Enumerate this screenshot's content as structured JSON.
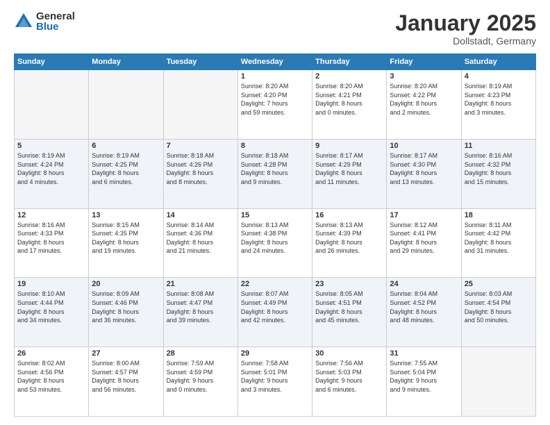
{
  "header": {
    "logo_general": "General",
    "logo_blue": "Blue",
    "month_title": "January 2025",
    "subtitle": "Dollstadt, Germany"
  },
  "days_of_week": [
    "Sunday",
    "Monday",
    "Tuesday",
    "Wednesday",
    "Thursday",
    "Friday",
    "Saturday"
  ],
  "weeks": [
    [
      {
        "day": "",
        "info": ""
      },
      {
        "day": "",
        "info": ""
      },
      {
        "day": "",
        "info": ""
      },
      {
        "day": "1",
        "info": "Sunrise: 8:20 AM\nSunset: 4:20 PM\nDaylight: 7 hours\nand 59 minutes."
      },
      {
        "day": "2",
        "info": "Sunrise: 8:20 AM\nSunset: 4:21 PM\nDaylight: 8 hours\nand 0 minutes."
      },
      {
        "day": "3",
        "info": "Sunrise: 8:20 AM\nSunset: 4:22 PM\nDaylight: 8 hours\nand 2 minutes."
      },
      {
        "day": "4",
        "info": "Sunrise: 8:19 AM\nSunset: 4:23 PM\nDaylight: 8 hours\nand 3 minutes."
      }
    ],
    [
      {
        "day": "5",
        "info": "Sunrise: 8:19 AM\nSunset: 4:24 PM\nDaylight: 8 hours\nand 4 minutes."
      },
      {
        "day": "6",
        "info": "Sunrise: 8:19 AM\nSunset: 4:25 PM\nDaylight: 8 hours\nand 6 minutes."
      },
      {
        "day": "7",
        "info": "Sunrise: 8:18 AM\nSunset: 4:26 PM\nDaylight: 8 hours\nand 8 minutes."
      },
      {
        "day": "8",
        "info": "Sunrise: 8:18 AM\nSunset: 4:28 PM\nDaylight: 8 hours\nand 9 minutes."
      },
      {
        "day": "9",
        "info": "Sunrise: 8:17 AM\nSunset: 4:29 PM\nDaylight: 8 hours\nand 11 minutes."
      },
      {
        "day": "10",
        "info": "Sunrise: 8:17 AM\nSunset: 4:30 PM\nDaylight: 8 hours\nand 13 minutes."
      },
      {
        "day": "11",
        "info": "Sunrise: 8:16 AM\nSunset: 4:32 PM\nDaylight: 8 hours\nand 15 minutes."
      }
    ],
    [
      {
        "day": "12",
        "info": "Sunrise: 8:16 AM\nSunset: 4:33 PM\nDaylight: 8 hours\nand 17 minutes."
      },
      {
        "day": "13",
        "info": "Sunrise: 8:15 AM\nSunset: 4:35 PM\nDaylight: 8 hours\nand 19 minutes."
      },
      {
        "day": "14",
        "info": "Sunrise: 8:14 AM\nSunset: 4:36 PM\nDaylight: 8 hours\nand 21 minutes."
      },
      {
        "day": "15",
        "info": "Sunrise: 8:13 AM\nSunset: 4:38 PM\nDaylight: 8 hours\nand 24 minutes."
      },
      {
        "day": "16",
        "info": "Sunrise: 8:13 AM\nSunset: 4:39 PM\nDaylight: 8 hours\nand 26 minutes."
      },
      {
        "day": "17",
        "info": "Sunrise: 8:12 AM\nSunset: 4:41 PM\nDaylight: 8 hours\nand 29 minutes."
      },
      {
        "day": "18",
        "info": "Sunrise: 8:11 AM\nSunset: 4:42 PM\nDaylight: 8 hours\nand 31 minutes."
      }
    ],
    [
      {
        "day": "19",
        "info": "Sunrise: 8:10 AM\nSunset: 4:44 PM\nDaylight: 8 hours\nand 34 minutes."
      },
      {
        "day": "20",
        "info": "Sunrise: 8:09 AM\nSunset: 4:46 PM\nDaylight: 8 hours\nand 36 minutes."
      },
      {
        "day": "21",
        "info": "Sunrise: 8:08 AM\nSunset: 4:47 PM\nDaylight: 8 hours\nand 39 minutes."
      },
      {
        "day": "22",
        "info": "Sunrise: 8:07 AM\nSunset: 4:49 PM\nDaylight: 8 hours\nand 42 minutes."
      },
      {
        "day": "23",
        "info": "Sunrise: 8:05 AM\nSunset: 4:51 PM\nDaylight: 8 hours\nand 45 minutes."
      },
      {
        "day": "24",
        "info": "Sunrise: 8:04 AM\nSunset: 4:52 PM\nDaylight: 8 hours\nand 48 minutes."
      },
      {
        "day": "25",
        "info": "Sunrise: 8:03 AM\nSunset: 4:54 PM\nDaylight: 8 hours\nand 50 minutes."
      }
    ],
    [
      {
        "day": "26",
        "info": "Sunrise: 8:02 AM\nSunset: 4:56 PM\nDaylight: 8 hours\nand 53 minutes."
      },
      {
        "day": "27",
        "info": "Sunrise: 8:00 AM\nSunset: 4:57 PM\nDaylight: 8 hours\nand 56 minutes."
      },
      {
        "day": "28",
        "info": "Sunrise: 7:59 AM\nSunset: 4:59 PM\nDaylight: 9 hours\nand 0 minutes."
      },
      {
        "day": "29",
        "info": "Sunrise: 7:58 AM\nSunset: 5:01 PM\nDaylight: 9 hours\nand 3 minutes."
      },
      {
        "day": "30",
        "info": "Sunrise: 7:56 AM\nSunset: 5:03 PM\nDaylight: 9 hours\nand 6 minutes."
      },
      {
        "day": "31",
        "info": "Sunrise: 7:55 AM\nSunset: 5:04 PM\nDaylight: 9 hours\nand 9 minutes."
      },
      {
        "day": "",
        "info": ""
      }
    ]
  ]
}
